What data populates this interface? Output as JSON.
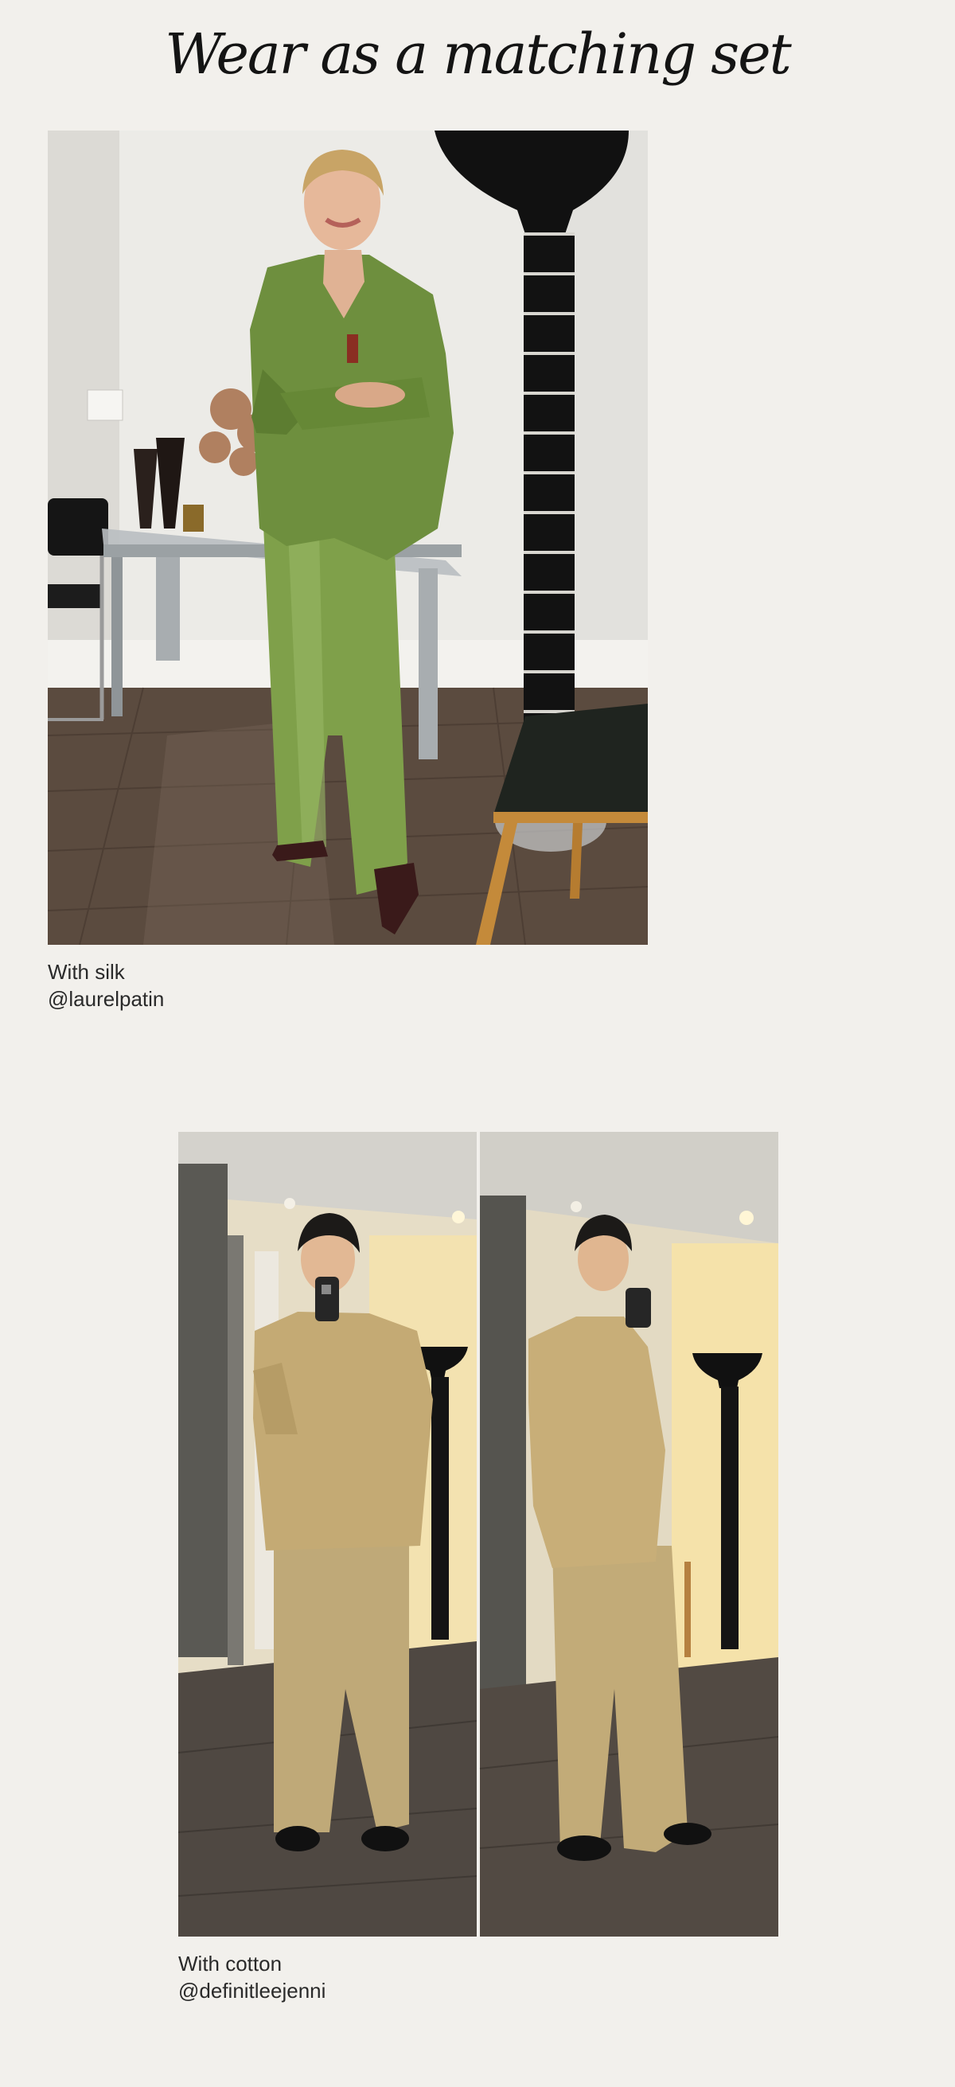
{
  "page": {
    "title": "Wear as a matching set"
  },
  "looks": [
    {
      "caption": "With silk",
      "handle": "@laurelpatin"
    },
    {
      "caption": "With cotton",
      "handle": "@definitleejenni"
    }
  ]
}
